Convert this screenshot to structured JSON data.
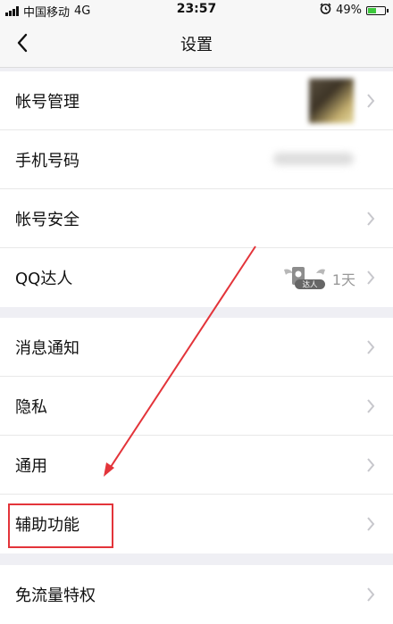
{
  "status_bar": {
    "carrier": "中国移动",
    "network": "4G",
    "time": "23:57",
    "battery": "49%"
  },
  "nav": {
    "title": "设置"
  },
  "groups": [
    {
      "items": [
        {
          "label": "帐号管理"
        },
        {
          "label": "手机号码"
        },
        {
          "label": "帐号安全"
        },
        {
          "label": "QQ达人",
          "badge_text": "达人",
          "value": "1天"
        }
      ]
    },
    {
      "items": [
        {
          "label": "消息通知"
        },
        {
          "label": "隐私"
        },
        {
          "label": "通用"
        },
        {
          "label": "辅助功能"
        }
      ]
    },
    {
      "items": [
        {
          "label": "免流量特权"
        }
      ]
    }
  ],
  "colors": {
    "annotation": "#e3343a",
    "battery": "#3cc83c"
  }
}
